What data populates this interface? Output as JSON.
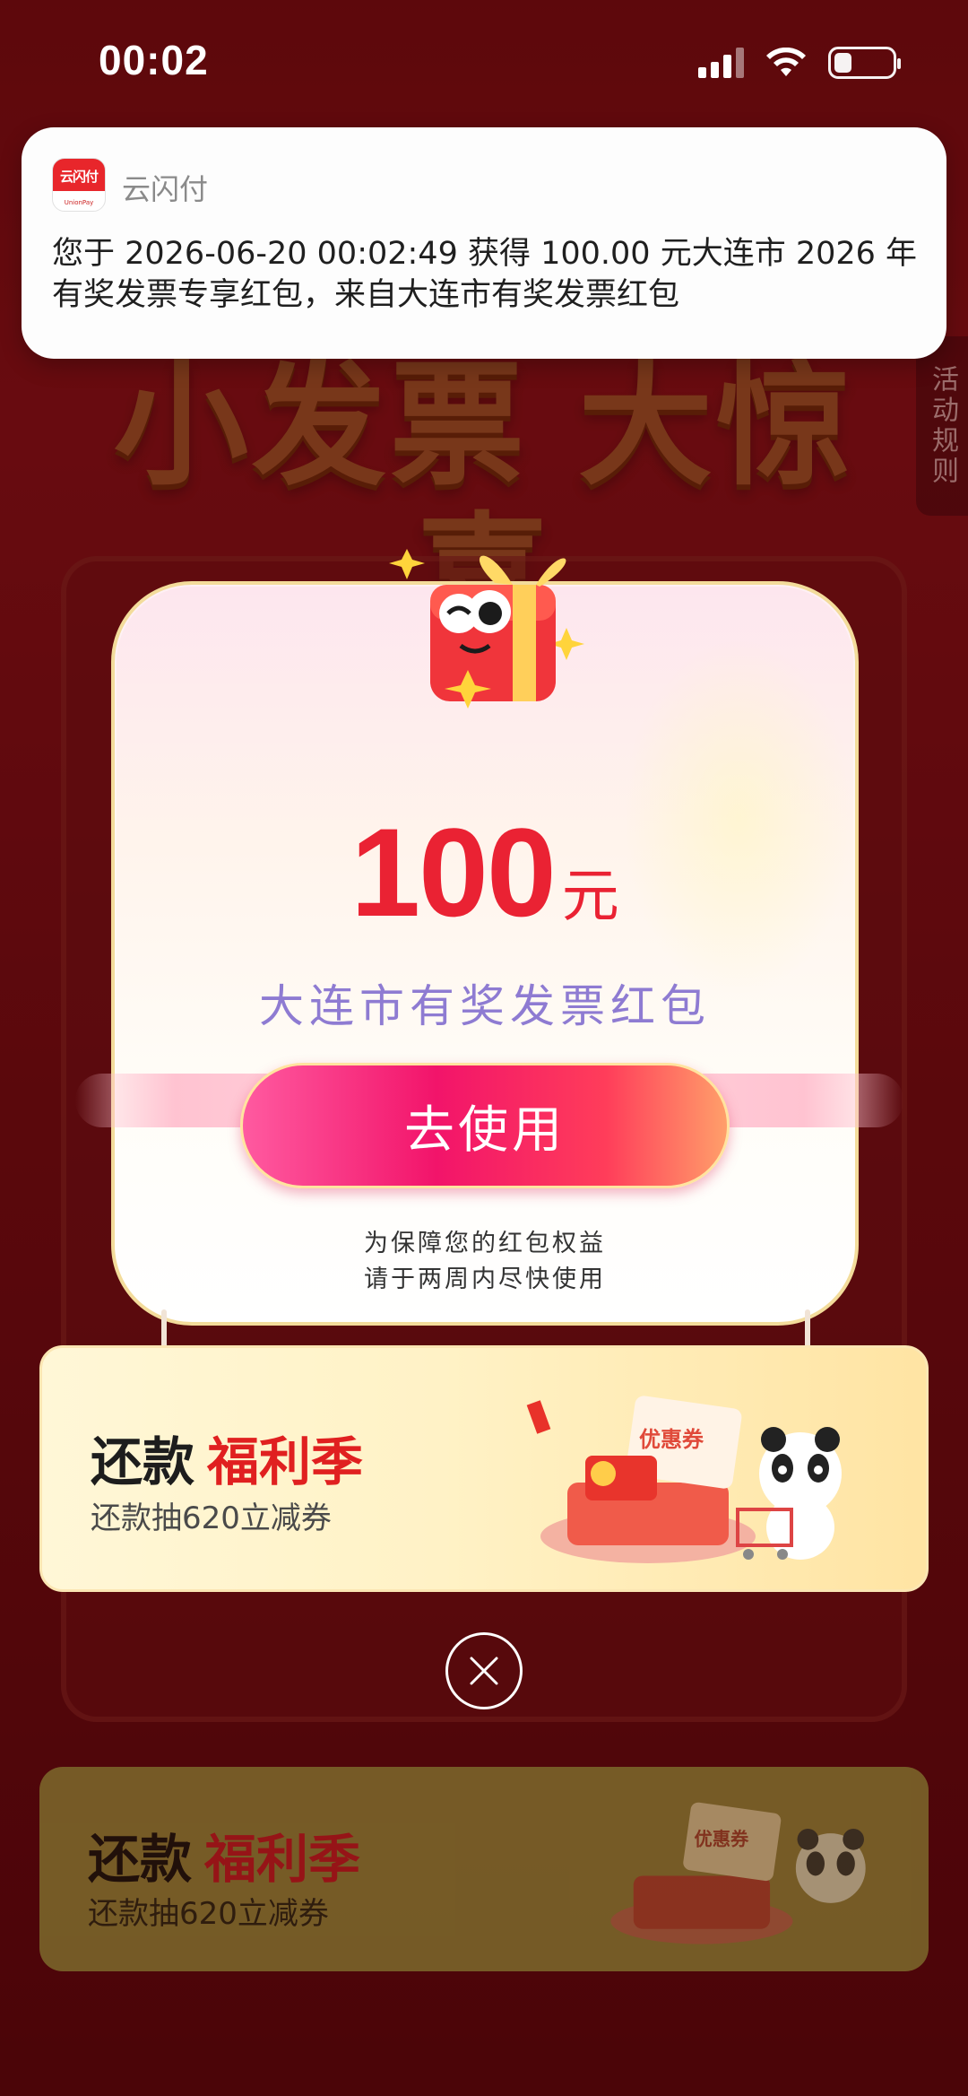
{
  "status_bar": {
    "time": "00:02",
    "icons": [
      "signal-icon",
      "wifi-icon",
      "battery-icon"
    ],
    "battery_level": 0.3
  },
  "notification": {
    "app_name": "云闪付",
    "app_icon_text": "云闪付",
    "app_icon_subtext": "UnionPay",
    "message": "您于 2026-06-20 00:02:49 获得 100.00 元大连市 2026 年有奖发票专享红包，来自大连市有奖发票红包"
  },
  "background": {
    "hero_title": "小发票 大惊喜",
    "rules_tab": "活动规则"
  },
  "popup": {
    "amount": "100",
    "unit": "元",
    "title": "大连市有奖发票红包",
    "button_label": "去使用",
    "note_line1": "为保障您的红包权益",
    "note_line2": "请于两周内尽快使用"
  },
  "promo": {
    "title": "还款",
    "title_accent": "福利季",
    "subtitle": "还款抽620立减券",
    "art_label": "优惠券"
  },
  "bg_promo": {
    "title": "还款",
    "title_accent": "福利季",
    "subtitle": "还款抽620立减券",
    "art_label": "优惠券"
  },
  "colors": {
    "accent_red": "#ea2233",
    "title_purple": "#8e7bd2",
    "button_pink": "#f2146a"
  }
}
